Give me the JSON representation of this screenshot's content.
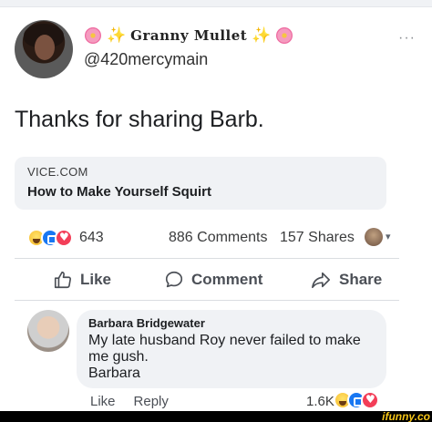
{
  "post": {
    "author": {
      "display_name": "Granny Mullet",
      "handle": "@420mercymain",
      "name_decorations": [
        "blossom-emoji",
        "sparkles-emoji",
        "sparkles-emoji",
        "blossom-emoji"
      ]
    },
    "more_label": "···",
    "text": "Thanks for sharing Barb.",
    "link": {
      "domain": "VICE.COM",
      "title": "How to Make Yourself Squirt"
    },
    "stats": {
      "reaction_icons": [
        "haha-icon",
        "like-icon",
        "love-icon"
      ],
      "reactions": "643",
      "comments": "886 Comments",
      "shares": "157 Shares",
      "caret": "▾"
    },
    "actions": {
      "like": "Like",
      "comment": "Comment",
      "share": "Share"
    }
  },
  "comment": {
    "author": "Barbara Bridgewater",
    "text": "My late husband Roy never failed to make me gush.\nBarbara",
    "like_label": "Like",
    "reply_label": "Reply",
    "reactions": "1.6K",
    "reaction_icons": [
      "haha-icon",
      "like-icon",
      "love-icon"
    ]
  },
  "watermark": "ifunny.co",
  "colors": {
    "accent_blue": "#1877f2",
    "love_red": "#f33e58",
    "haha_yellow": "#f7b928",
    "bubble_gray": "#f0f2f5",
    "watermark_yellow": "#f5c518"
  }
}
